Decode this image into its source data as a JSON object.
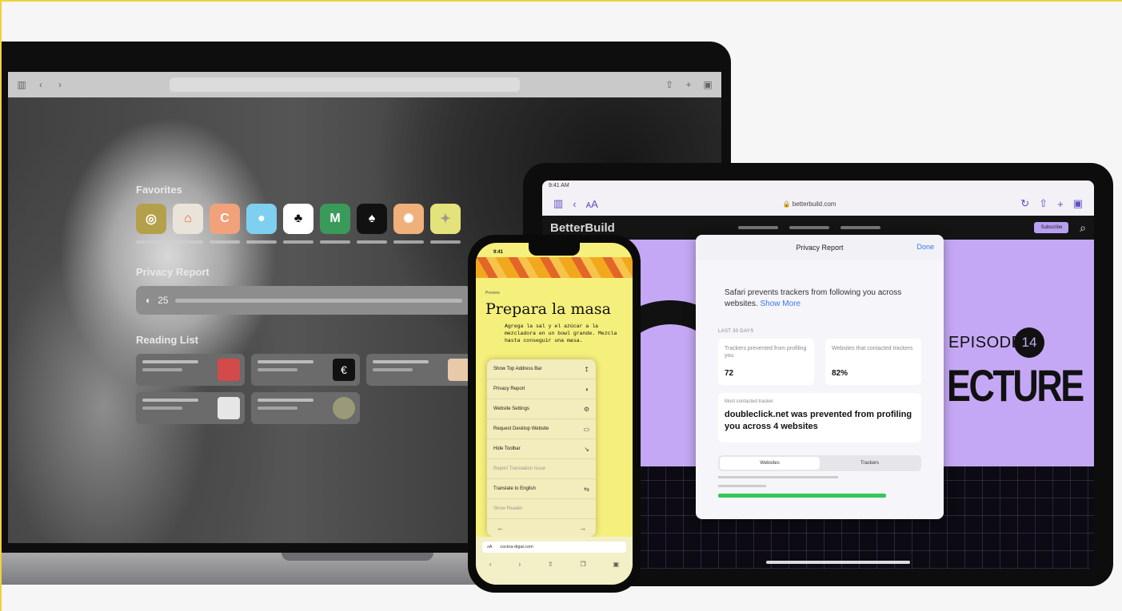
{
  "colors": {
    "accent": "#3478f6",
    "hero": "#c5a8f5",
    "phone_bg": "#f5ef7c",
    "tracker_green": "#34c759"
  },
  "mac": {
    "sections": {
      "favorites": "Favorites",
      "privacy": "Privacy Report",
      "reading": "Reading List"
    },
    "privacy_count": "25",
    "favorites_icons": [
      "clock-icon",
      "home-icon",
      "c-icon",
      "balloon-icon",
      "shape-icon",
      "m-icon",
      "tree-icon",
      "sun-icon",
      "star-icon"
    ],
    "favorites_letters": [
      "M",
      "C"
    ]
  },
  "ipad": {
    "status_time": "9:41 AM",
    "url": "betterbuild.com",
    "brand": "BetterBuild",
    "subscribe": "Subscribe",
    "episode_label": "EPISODE",
    "episode_number": "14",
    "hero_title": "ECTURE"
  },
  "privacy_sheet": {
    "title": "Privacy Report",
    "done": "Done",
    "description": "Safari prevents trackers from following you across websites.",
    "learn_more": "Show More",
    "section_label": "LAST 30 DAYS",
    "stat1_label": "Trackers prevented from profiling you",
    "stat1_value": "72",
    "stat2_label": "Websites that contacted trackers",
    "stat2_value": "82%",
    "tracker_label": "Most contacted tracker",
    "tracker_text": "doubleclick.net was prevented from profiling you across 4 websites",
    "seg_websites": "Websites",
    "seg_trackers": "Trackers"
  },
  "iphone": {
    "time": "9:41",
    "kicker": "Preview",
    "recipe_title": "Prepara la masa",
    "recipe_body": "Agrega la sal y el azúcar a la mezcladora en un bowl grande. Mezcla hasta conseguir una masa.",
    "menu": [
      {
        "label": "Show Top Address Bar",
        "icon": "↥",
        "dim": false
      },
      {
        "label": "Privacy Report",
        "icon": "◐",
        "dim": false
      },
      {
        "label": "Website Settings",
        "icon": "⚙",
        "dim": false
      },
      {
        "label": "Request Desktop Website",
        "icon": "▭",
        "dim": false
      },
      {
        "label": "Hide Toolbar",
        "icon": "↘",
        "dim": false
      },
      {
        "label": "Report Translation Issue",
        "icon": "",
        "dim": true
      },
      {
        "label": "Translate to English",
        "icon": "⇆",
        "dim": false
      },
      {
        "label": "Show Reader",
        "icon": "",
        "dim": true
      }
    ],
    "url": "cocina-digal.com"
  }
}
